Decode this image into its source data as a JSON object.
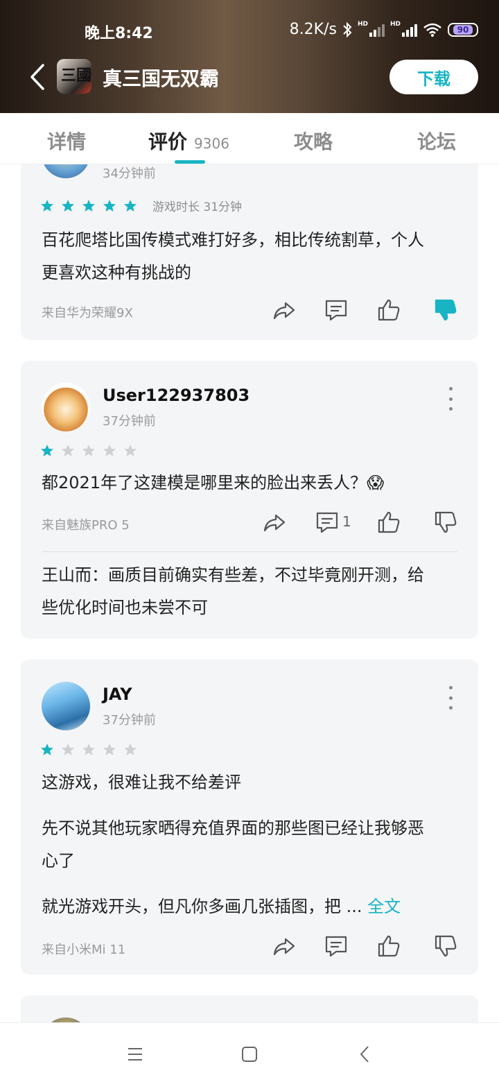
{
  "status_bar": {
    "time": "晚上8:42",
    "net_speed": "8.2K/s",
    "hd1": "HD",
    "hd2": "HD",
    "battery": "90"
  },
  "header": {
    "title": "真三国无双霸",
    "download_label": "下载",
    "icon_text": "三國"
  },
  "tabs": [
    {
      "label": "详情",
      "count": ""
    },
    {
      "label": "评价",
      "count": "9306"
    },
    {
      "label": "攻略",
      "count": ""
    },
    {
      "label": "论坛",
      "count": ""
    }
  ],
  "reviews": [
    {
      "time": "34分钟前",
      "rating": 5,
      "playtime": "游戏时长 31分钟",
      "lines": [
        "百花爬塔比国传模式难打好多，相比传统割草，个人",
        "更喜欢这种有挑战的"
      ],
      "device": "来自华为荣耀9X"
    },
    {
      "username": "User122937803",
      "time": "37分钟前",
      "rating": 1,
      "lines": [
        "都2021年了这建模是哪里来的脸出来丢人？😱"
      ],
      "device": "来自魅族PRO 5",
      "comment_count": "1",
      "reply": [
        "王山而：画质目前确实有些差，不过毕竟刚开测，给",
        "些优化时间也未尝不可"
      ]
    },
    {
      "username": "JAY",
      "time": "37分钟前",
      "rating": 1,
      "lines": [
        "这游戏，很难让我不给差评",
        "先不说其他玩家晒得充值界面的那些图已经让我够恶",
        "心了",
        "就光游戏开头，但凡你多画几张插图，把 ... "
      ],
      "full_text_link": "全文",
      "device": "来自小米Mi 11"
    }
  ],
  "colors": {
    "accent": "#17b4c4",
    "star_off": "#d0d0d0",
    "card_bg": "#f4f5f7"
  },
  "icons": [
    "back-arrow-icon",
    "share-icon",
    "comment-icon",
    "thumbs-up-icon",
    "thumbs-down-icon",
    "more-icon",
    "menu-icon",
    "home-square-icon",
    "nav-back-icon"
  ]
}
